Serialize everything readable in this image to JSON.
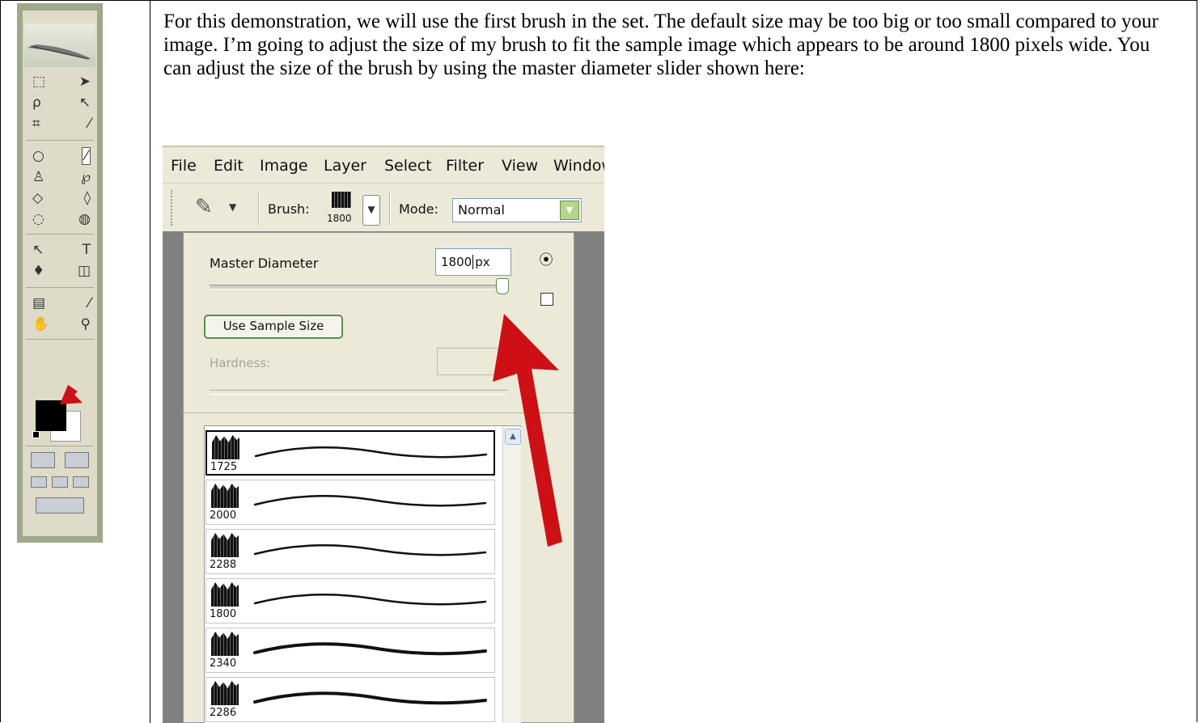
{
  "paragraph": "For this demonstration, we will use the first brush in the set. The default size may be too big or too small compared to your image. I’m going to adjust the size of my brush to fit the sample image which appears to be around 1800 pixels wide. You can adjust the size of the brush by using the master diameter slider shown here:",
  "menu": [
    "File",
    "Edit",
    "Image",
    "Layer",
    "Select",
    "Filter",
    "View",
    "Window"
  ],
  "options_bar": {
    "brush_label": "Brush:",
    "brush_size": "1800",
    "mode_label": "Mode:",
    "mode_value": "Normal"
  },
  "brush_panel": {
    "master_diameter_label": "Master Diameter",
    "master_diameter_value": "1800",
    "master_diameter_unit": "px",
    "master_diameter_slider_fraction": 0.98,
    "use_sample_size_label": "Use Sample Size",
    "hardness_label": "Hardness:",
    "brushes": [
      {
        "size": "1725",
        "selected": true
      },
      {
        "size": "2000",
        "selected": false
      },
      {
        "size": "2288",
        "selected": false
      },
      {
        "size": "1800",
        "selected": false
      },
      {
        "size": "2340",
        "selected": false
      },
      {
        "size": "2286",
        "selected": false
      }
    ]
  },
  "icons": {
    "toolbox": "photoshop-toolbox",
    "foreground_color": "#000000",
    "background_color": "#ffffff",
    "annotation_arrow_color": "#cc1016"
  }
}
